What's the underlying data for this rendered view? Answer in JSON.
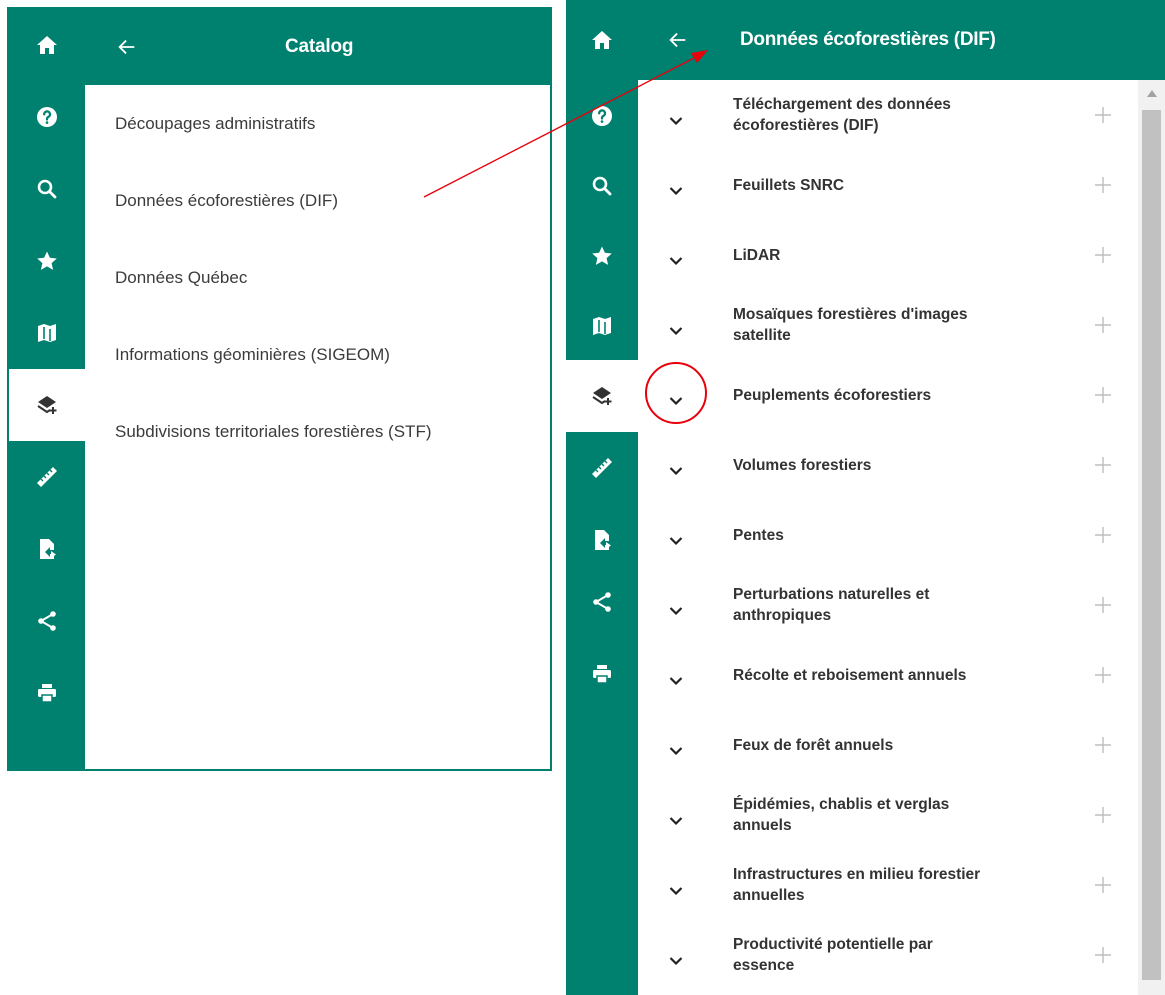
{
  "left_panel": {
    "title": "Catalog",
    "items": [
      "Découpages administratifs",
      "Données écoforestières (DIF)",
      "Données Québec",
      "Informations géominières (SIGEOM)",
      "Subdivisions territoriales forestières (STF)"
    ]
  },
  "right_panel": {
    "title": "Données écoforestières (DIF)",
    "layers": [
      {
        "line1": "Téléchargement des données",
        "line2": "écoforestières (DIF)"
      },
      {
        "line1": "Feuillets SNRC",
        "line2": ""
      },
      {
        "line1": "LiDAR",
        "line2": ""
      },
      {
        "line1": "Mosaïques forestières d'images",
        "line2": "satellite"
      },
      {
        "line1": "Peuplements écoforestiers",
        "line2": ""
      },
      {
        "line1": "Volumes forestiers",
        "line2": ""
      },
      {
        "line1": "Pentes",
        "line2": ""
      },
      {
        "line1": "Perturbations naturelles et",
        "line2": "anthropiques"
      },
      {
        "line1": "Récolte et reboisement annuels",
        "line2": ""
      },
      {
        "line1": "Feux de forêt annuels",
        "line2": ""
      },
      {
        "line1": "Épidémies, chablis et verglas",
        "line2": "annuels"
      },
      {
        "line1": "Infrastructures en milieu forestier",
        "line2": "annuelles"
      },
      {
        "line1": "Productivité potentielle par",
        "line2": "essence"
      }
    ]
  },
  "iconbar_icons": [
    "home-icon",
    "help-icon",
    "search-icon",
    "star-icon",
    "map-icon",
    "add-layer-icon",
    "ruler-icon",
    "export-file-icon",
    "share-icon",
    "print-icon"
  ],
  "colors": {
    "brand": "#00806f",
    "annotation": "#e8000b"
  }
}
